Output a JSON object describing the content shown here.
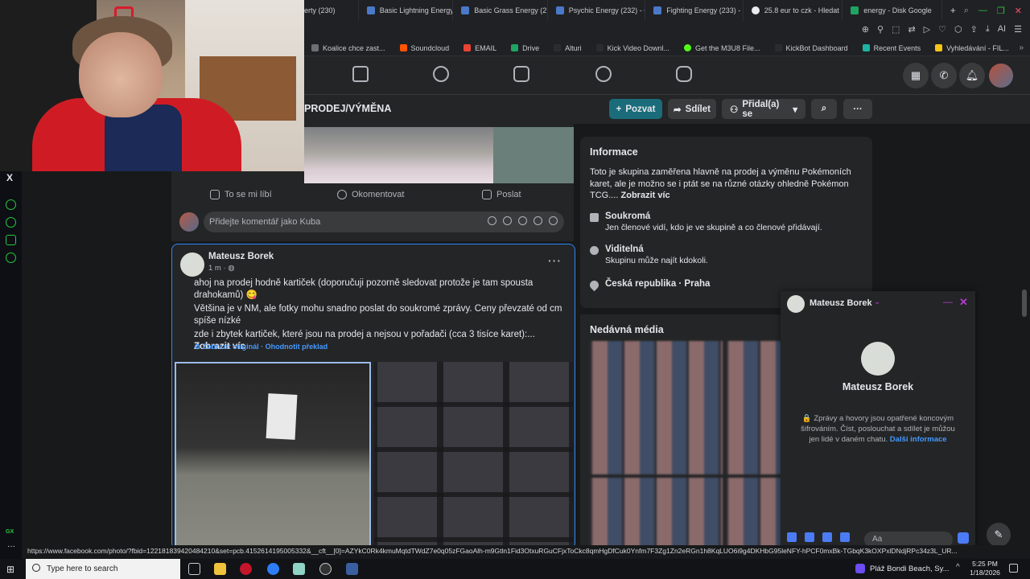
{
  "browser": {
    "tabs": [
      {
        "label": "erty (230)"
      },
      {
        "label": "Basic Lightning Energy [..."
      },
      {
        "label": "Basic Grass Energy (278..."
      },
      {
        "label": "Psychic Energy (232) - C..."
      },
      {
        "label": "Fighting Energy (233) - C"
      },
      {
        "label": "25.8 eur to czk - Hledat"
      },
      {
        "label": "energy - Disk Google"
      }
    ],
    "new_tab": "+",
    "ai_label": "AI",
    "bookmarks": [
      {
        "label": "Koalice chce zast...",
        "color": "#6c6f75"
      },
      {
        "label": "Soundcloud",
        "color": "#ff5500"
      },
      {
        "label": "EMAIL",
        "color": "#ea4335"
      },
      {
        "label": "Drive",
        "color": "#1fa463"
      },
      {
        "label": "Alturi",
        "color": "#2b2c30"
      },
      {
        "label": "Kick Video Downl...",
        "color": "#2b2c30"
      },
      {
        "label": "Get the M3U8 File...",
        "color": "#53fc18"
      },
      {
        "label": "KickBot Dashboard",
        "color": "#2b2c30"
      },
      {
        "label": "Recent Events",
        "color": "#1fb2a6"
      },
      {
        "label": "Vyhledávání - FIL...",
        "color": "#f5c518"
      }
    ],
    "bookmarks_more": "»"
  },
  "gx_sidebar": {
    "x_label": "X",
    "gx_label": "GX",
    "more": "···"
  },
  "group": {
    "title": "PRODEJ/VÝMĚNA",
    "invite_label": "Pozvat",
    "share_label": "Sdílet",
    "joined_label": "Přidal(a) se"
  },
  "prev_post": {
    "like_label": "To se mi líbí",
    "comment_label": "Okomentovat",
    "send_label": "Poslat",
    "comment_placeholder": "Přidejte komentář jako Kuba"
  },
  "post": {
    "author": "Mateusz Borek",
    "time": "1 m · ",
    "paragraph1": "ahoj na prodej hodně kartiček (doporučuji pozorně sledovat protože je tam spousta drahokamů) 😋",
    "paragraph2": "Většina je v NM, ale fotky mohu snadno poslat do soukromé zprávy. Ceny převzaté od cm spíše nízké",
    "paragraph3": "zde i zbytek kartiček, které jsou na prodej a nejsou v pořadači (cca 3 tisíce karet):...",
    "see_more": "Zobrazit víc",
    "show_original": "Zobrazit originál",
    "rate_translation": "Ohodnotit překlad",
    "separator": " · "
  },
  "info": {
    "title": "Informace",
    "description": "Toto je skupina zaměřena hlavně na prodej a výměnu Pokémoních karet, ale je možno se i ptát se na různé otázky ohledně Pokémon TCG....",
    "see_more": "Zobrazit víc",
    "private_title": "Soukromá",
    "private_desc": "Jen členové vidí, kdo je ve skupině a co členové přidávají.",
    "visible_title": "Viditelná",
    "visible_desc": "Skupinu může najít kdokoli.",
    "location": "Česká republika · Praha"
  },
  "media": {
    "title": "Nedávná média"
  },
  "chat": {
    "name": "Mateusz Borek",
    "chevron": "⌄",
    "minimize": "—",
    "close": "✕",
    "e2e_text": "🔒 Zprávy a hovory jsou opatřené koncovým šifrováním. Číst, poslouchat a sdílet je můžou jen lidé v daném chatu.",
    "e2e_link": "Další informace",
    "input_placeholder": "Aa"
  },
  "status_url": "https://www.facebook.com/photo/?fbid=122181839420484210&set=pcb.4152614195005332&__cft__[0]=AZYkC0Rk4kmuMqtdTWdZ7e0q05zFGaoAlh-m9Gtln1Fid3OtxuRGuCFjxToCkc8qmHgDfCuk0Ynfm7F3Zg1Zn2eRGn1h8KqLUO6i9g4DKHbG95leNFY-hPCF0mxBk-TGbqK3kOXPxlDNdjRPc34z3L_UR...",
  "taskbar": {
    "search_placeholder": "Type here to search",
    "weather": "Pláž Bondi Beach, Sy...",
    "tray_chevron": "^",
    "time": "5:25 PM",
    "date": "1/18/2026"
  }
}
